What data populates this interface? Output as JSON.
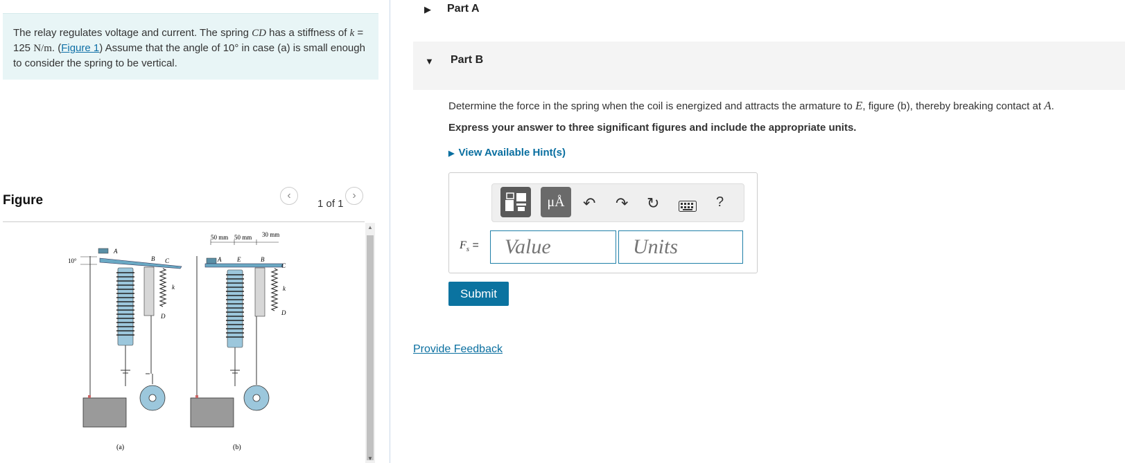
{
  "problem": {
    "text_1": "The relay regulates voltage and current. The spring ",
    "var_cd": "CD",
    "text_2": " has a stiffness of ",
    "var_k": "k",
    "text_3": " = 125 ",
    "unit": "N/m",
    "text_4": ". (",
    "figure_link": "Figure 1",
    "text_5": ") Assume that the angle of 10° in case (a) is small enough to consider the spring to be vertical."
  },
  "figure": {
    "title": "Figure",
    "pager": "1 of 1",
    "prev_icon": "chevron-left-icon",
    "next_icon": "chevron-right-icon",
    "labels": {
      "angle": "10°",
      "dim_1": "50 mm",
      "dim_2": "50 mm",
      "dim_3": "30 mm",
      "a": "A",
      "b": "B",
      "c": "C",
      "d": "D",
      "e": "E",
      "k": "k",
      "case_a": "(a)",
      "case_b": "(b)"
    }
  },
  "parts": {
    "part_a": "Part A",
    "part_b": "Part B"
  },
  "question": {
    "text_1": "Determine the force in the spring when the coil is energized and attracts the armature to ",
    "var_e": "E",
    "text_2": ", figure (b), thereby breaking contact at ",
    "var_a": "A",
    "text_3": ".",
    "instruction": "Express your answer to three significant figures and include the appropriate units.",
    "hint": "View Available Hint(s)"
  },
  "answer": {
    "label_var": "F",
    "label_sub": "s",
    "label_eq": " =",
    "value_placeholder": "Value",
    "units_placeholder": "Units",
    "help": "?",
    "units_button": "μÅ",
    "submit": "Submit"
  },
  "feedback": "Provide Feedback",
  "colors": {
    "accent": "#0b73a0",
    "problem_bg": "#e8f5f6",
    "coil": "#9cc7dc",
    "armature": "#6aa9c4"
  }
}
